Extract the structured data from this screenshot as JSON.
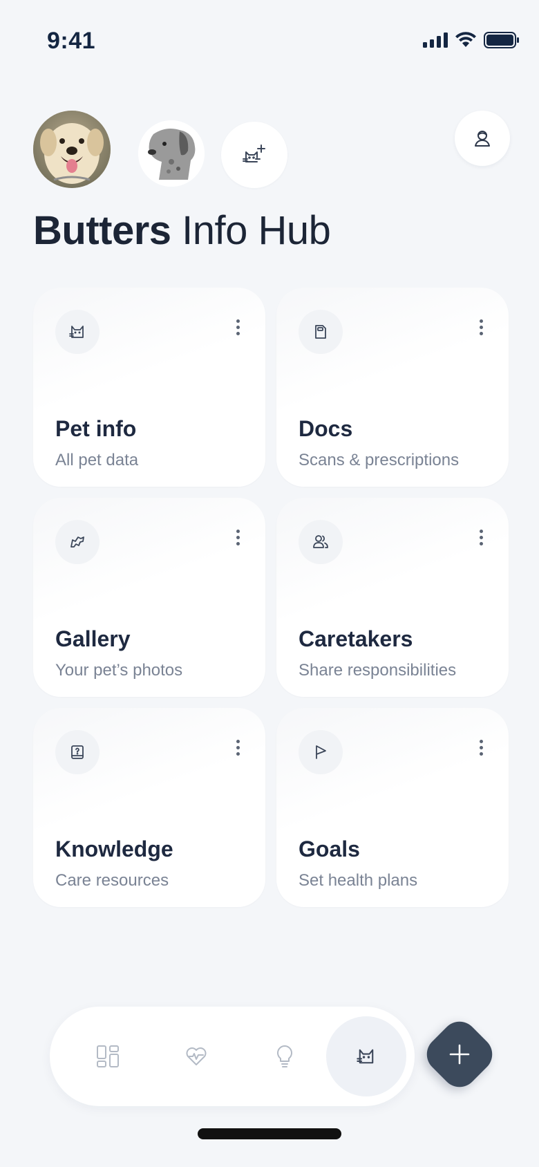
{
  "status_bar": {
    "time": "9:41"
  },
  "pets": {
    "main_pet_icon": "labrador-photo",
    "second_pet_icon": "dog-photo-grayscale",
    "add_pet_icon": "cat-plus-icon",
    "profile_icon": "user-icon"
  },
  "header": {
    "title_name": "Butters",
    "title_rest": "Info Hub"
  },
  "cards": [
    {
      "title": "Pet info",
      "subtitle": "All pet data",
      "icon": "cat-icon"
    },
    {
      "title": "Docs",
      "subtitle": "Scans & prescriptions",
      "icon": "document-icon"
    },
    {
      "title": "Gallery",
      "subtitle": "Your pet’s photos",
      "icon": "dog-icon"
    },
    {
      "title": "Caretakers",
      "subtitle": "Share responsibilities",
      "icon": "people-icon"
    },
    {
      "title": "Knowledge",
      "subtitle": "Care resources",
      "icon": "book-question-icon"
    },
    {
      "title": "Goals",
      "subtitle": "Set health plans",
      "icon": "flag-icon"
    }
  ],
  "bottom_nav": {
    "items": [
      "dashboard-icon",
      "heart-pulse-icon",
      "lightbulb-icon",
      "cat-icon"
    ],
    "active_index": 3,
    "fab_icon": "plus-icon"
  },
  "colors": {
    "background": "#f4f6f9",
    "text_primary": "#1e2940",
    "text_secondary": "#7a8394",
    "fab": "#3c4a5c",
    "nav_active": "#eef1f6"
  }
}
